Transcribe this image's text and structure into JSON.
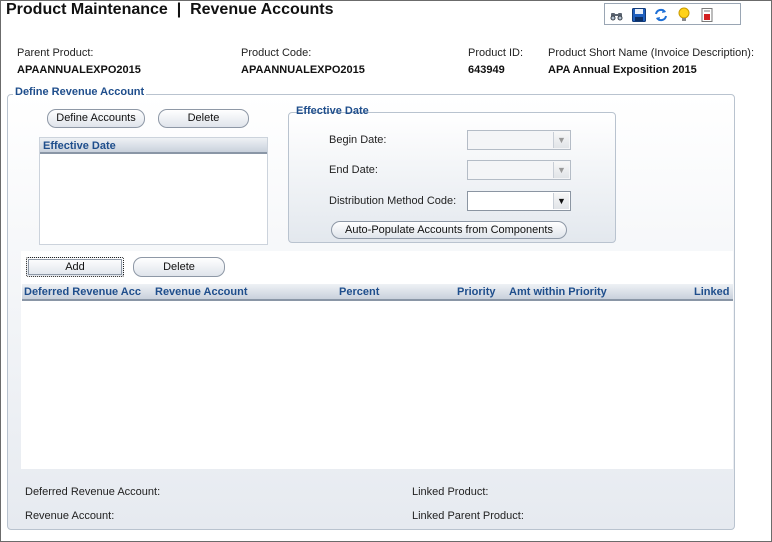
{
  "header": {
    "title": "Product Maintenance  |  Revenue Accounts",
    "toolbar_icons": [
      "binoculars-icon",
      "save-icon",
      "refresh-icon",
      "lightbulb-icon",
      "report-icon"
    ]
  },
  "info": {
    "parent_product_label": "Parent Product:",
    "parent_product_value": "APAANNUALEXPO2015",
    "product_code_label": "Product Code:",
    "product_code_value": "APAANNUALEXPO2015",
    "product_id_label": "Product ID:",
    "product_id_value": "643949",
    "short_name_label": "Product Short Name (Invoice Description):",
    "short_name_value": "APA Annual Exposition 2015"
  },
  "define": {
    "section_title": "Define Revenue Account",
    "define_accounts_button": "Define Accounts",
    "delete_button": "Delete",
    "list_header": "Effective Date"
  },
  "effective_date": {
    "section_title": "Effective Date",
    "begin_date_label": "Begin Date:",
    "begin_date_value": "",
    "end_date_label": "End Date:",
    "end_date_value": "",
    "distribution_label": "Distribution Method Code:",
    "distribution_value": "",
    "auto_populate_button": "Auto-Populate Accounts from Components"
  },
  "grid": {
    "add_button": "Add",
    "delete_button": "Delete",
    "columns": [
      "Deferred Revenue Acc",
      "Revenue Account",
      "Percent",
      "Priority",
      "Amt within Priority",
      "Linked"
    ]
  },
  "footer": {
    "deferred_revenue_label": "Deferred Revenue Account:",
    "revenue_account_label": "Revenue Account:",
    "linked_product_label": "Linked Product:",
    "linked_parent_label": "Linked Parent Product:"
  },
  "colors": {
    "accent_text": "#1f4e8c",
    "border": "#b9c3cf"
  }
}
